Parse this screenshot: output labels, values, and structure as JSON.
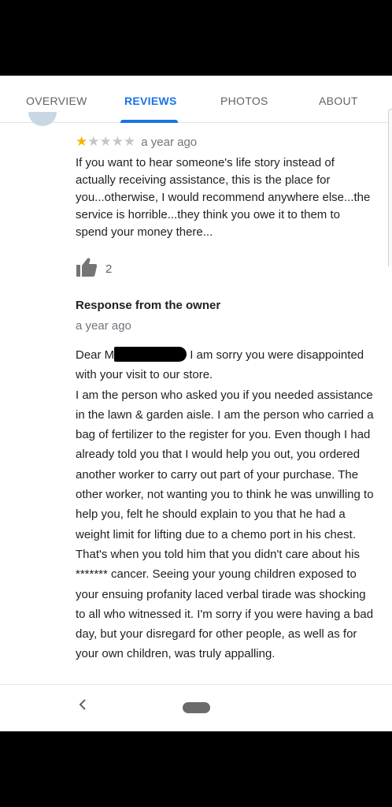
{
  "tabs": [
    {
      "label": "OVERVIEW"
    },
    {
      "label": "REVIEWS"
    },
    {
      "label": "PHOTOS"
    },
    {
      "label": "ABOUT"
    }
  ],
  "review": {
    "rating": 1,
    "max_rating": 5,
    "time": "a year ago",
    "text": "If you want to hear someone's life story instead of actually receiving assistance, this is the place for you...otherwise, I would recommend anywhere else...the service is horrible...they think you owe it to them to spend your money there...",
    "likes": "2"
  },
  "owner_response": {
    "title": "Response from the owner",
    "time": "a year ago",
    "salutation": "Dear M",
    "first_line_rest": "I am sorry you were disappointed with your visit to our store.",
    "body": "I am the person who asked you if you needed assistance in the lawn & garden aisle. I am the person who carried a bag of fertilizer to the register for you. Even though I had already told you that I would help you out, you ordered another worker to carry out part of your purchase. The other worker, not wanting you to think he was unwilling to help you, felt he should explain to you that he had a weight limit for lifting due to a chemo port in his chest. That's when you told him that you didn't care about his ******* cancer. Seeing your young children exposed to your ensuing profanity laced verbal tirade was shocking to all who witnessed it. I'm sorry if you were having a bad day, but your disregard for other people, as well as for your own children, was truly appalling."
  },
  "icons": {
    "like": "thumbs-up-icon",
    "back": "back-chevron-icon",
    "home": "home-pill-icon"
  },
  "colors": {
    "accent": "#1a73e8",
    "star_filled": "#f4b400",
    "star_empty": "#c6c6c6"
  }
}
